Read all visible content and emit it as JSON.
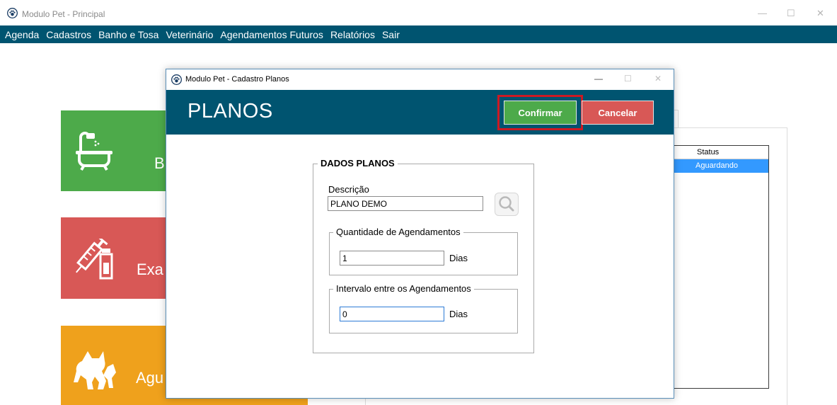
{
  "main_window": {
    "title": "Modulo Pet - Principal",
    "controls": {
      "minimize": "—",
      "maximize": "☐",
      "close": "✕"
    }
  },
  "menubar": {
    "items": [
      "Agenda",
      "Cadastros",
      "Banho e Tosa",
      "Veterinário",
      "Agendamentos Futuros",
      "Relatórios",
      "Sair"
    ]
  },
  "background_tiles": {
    "tile1": {
      "label": "B",
      "color": "#4daa4a",
      "icon": "bathtub-icon"
    },
    "tile2": {
      "label": "Exa",
      "color": "#d85856",
      "icon": "syringe-icon"
    },
    "tile3": {
      "label": "Agu",
      "color": "#efa11c",
      "icon": "pets-icon"
    }
  },
  "background_grid": {
    "header": "Status",
    "rows": [
      "Aguardando"
    ]
  },
  "dialog": {
    "title": "Modulo Pet - Cadastro Planos",
    "controls": {
      "minimize": "—",
      "maximize": "☐",
      "close": "✕"
    },
    "header_title": "PLANOS",
    "confirm_label": "Confirmar",
    "cancel_label": "Cancelar",
    "colors": {
      "header": "#005470",
      "confirm": "#4daa4a",
      "cancel": "#d85856",
      "highlight": "#cc1a24"
    },
    "group": {
      "legend": "DADOS PLANOS",
      "descricao_label": "Descrição",
      "descricao_value": "PLANO DEMO",
      "quantidade": {
        "legend": "Quantidade de Agendamentos",
        "value": "1",
        "unit": "Dias"
      },
      "intervalo": {
        "legend": "Intervalo entre os Agendamentos",
        "value": "0",
        "unit": "Dias"
      }
    }
  }
}
